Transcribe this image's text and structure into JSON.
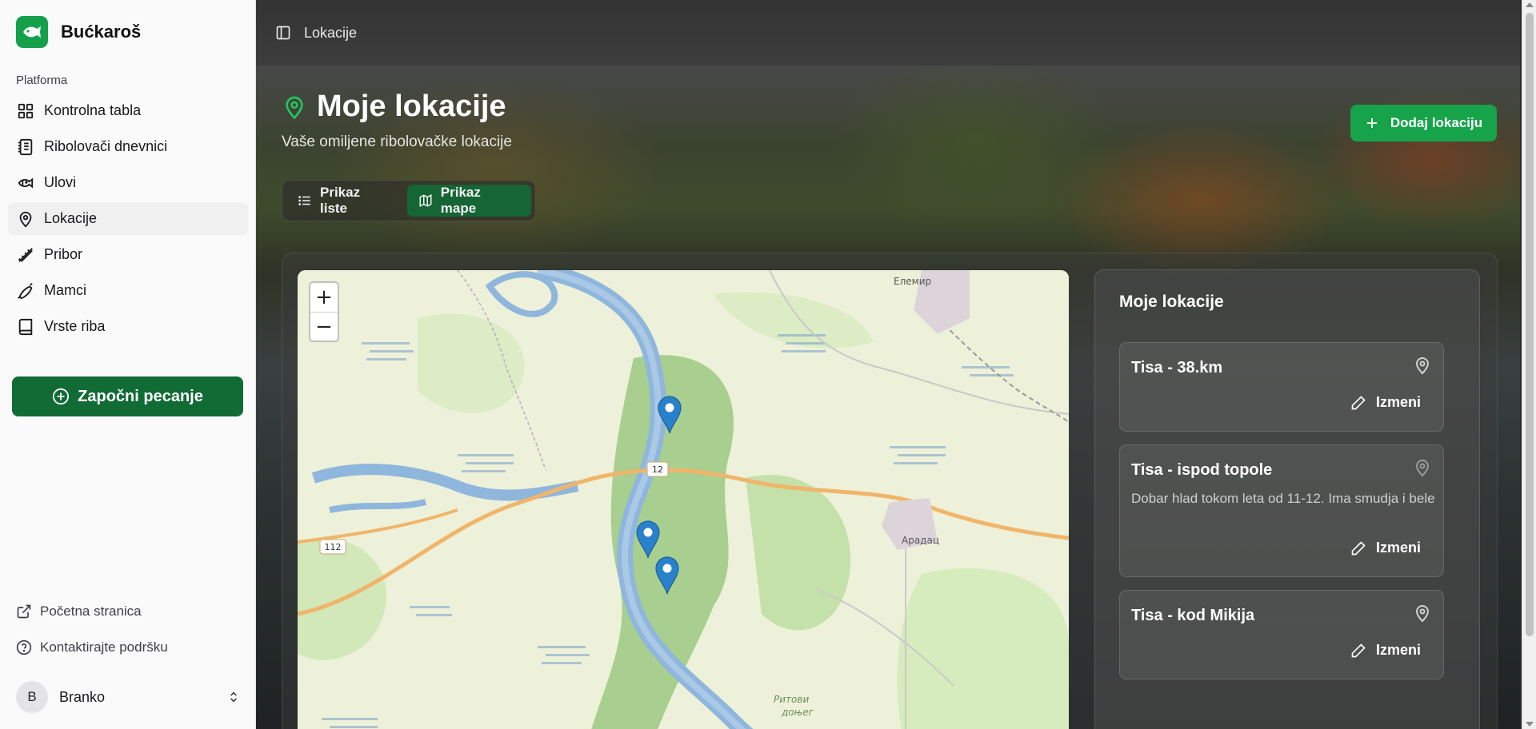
{
  "app": {
    "name": "Bućkaroš",
    "brand_color": "#14a04a"
  },
  "sidebar": {
    "section_label": "Platforma",
    "items": [
      {
        "label": "Kontrolna tabla",
        "icon": "grid-icon"
      },
      {
        "label": "Ribolovači dnevnici",
        "icon": "notebook-icon"
      },
      {
        "label": "Ulovi",
        "icon": "fish-icon"
      },
      {
        "label": "Lokacije",
        "icon": "map-pin-icon",
        "active": true
      },
      {
        "label": "Pribor",
        "icon": "fishing-rod-icon"
      },
      {
        "label": "Mamci",
        "icon": "lure-icon"
      },
      {
        "label": "Vrste riba",
        "icon": "book-icon"
      }
    ],
    "start_button": "Započni pecanje",
    "footer_links": [
      {
        "label": "Početna stranica",
        "icon": "external-link-icon"
      },
      {
        "label": "Kontaktirajte podršku",
        "icon": "help-circle-icon"
      }
    ],
    "user": {
      "initial": "B",
      "name": "Branko"
    }
  },
  "topbar": {
    "title": "Lokacije"
  },
  "page": {
    "title": "Moje lokacije",
    "subtitle": "Vaše omiljene ribolovačke lokacije",
    "add_button": "Dodaj lokaciju",
    "view_toggle": {
      "list_label": "Prikaz liste",
      "map_label": "Prikaz mape",
      "selected": "Prikaz mape"
    }
  },
  "map": {
    "zoom_in": "+",
    "zoom_out": "−",
    "labels": {
      "elemir": "Елемир",
      "aradac": "Арадац",
      "ritovi": "Ритови",
      "donjeg": "доњег",
      "road_12": "12",
      "road_112": "112"
    },
    "marker_count": 3
  },
  "locations_panel": {
    "title": "Moje lokacije",
    "edit_label": "Izmeni",
    "items": [
      {
        "name": "Tisa - 38.km",
        "description": ""
      },
      {
        "name": "Tisa - ispod topole",
        "description": "Dobar hlad tokom leta od 11-12. Ima smudja i bele"
      },
      {
        "name": "Tisa - kod Mikija",
        "description": ""
      }
    ]
  }
}
